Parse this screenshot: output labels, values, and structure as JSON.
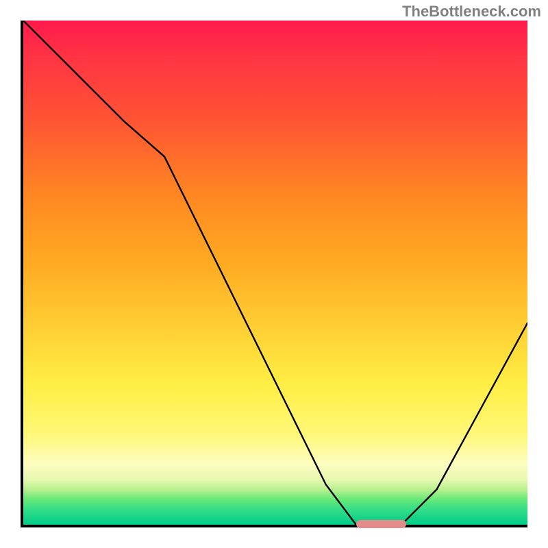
{
  "watermark": "TheBottleneck.com",
  "chart_data": {
    "type": "line",
    "title": "",
    "xlabel": "",
    "ylabel": "",
    "xlim": [
      0,
      100
    ],
    "ylim": [
      0,
      100
    ],
    "x": [
      0,
      8,
      20,
      28,
      60,
      66,
      75,
      82,
      100
    ],
    "values": [
      100,
      92,
      80,
      73,
      8,
      0,
      0,
      7,
      40
    ],
    "gradient_bands": [
      {
        "stop": 0,
        "color": "#ff1a4d"
      },
      {
        "stop": 50,
        "color": "#ffcc33"
      },
      {
        "stop": 88,
        "color": "#fdfdc0"
      },
      {
        "stop": 100,
        "color": "#00cc88"
      }
    ],
    "highlight_marker": {
      "x_start": 66,
      "x_end": 76,
      "color": "#e28b8b"
    }
  }
}
